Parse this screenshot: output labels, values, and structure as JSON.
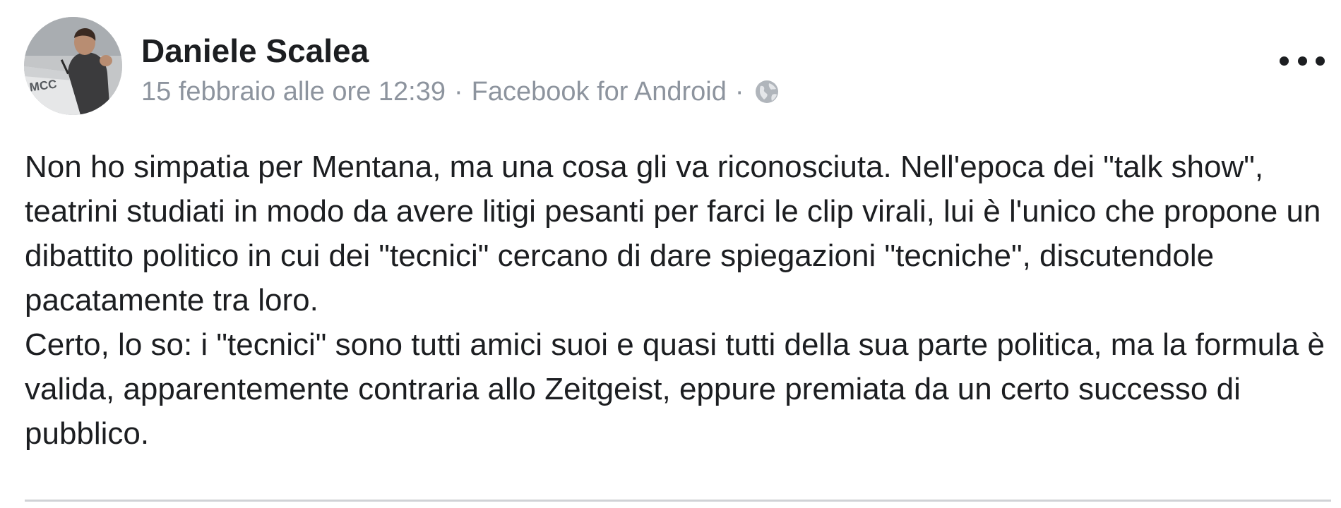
{
  "post": {
    "author_name": "Daniele Scalea",
    "meta": {
      "date": "15 febbraio alle ore 12:39",
      "separator": "·",
      "source": "Facebook for Android",
      "privacy_icon": "globe-icon"
    },
    "avatar": {
      "sign_text": "MCC"
    },
    "paragraphs": [
      "Non ho simpatia per Mentana, ma una cosa gli va riconosciuta. Nell'epoca dei \"talk show\", teatrini studiati in modo da avere litigi pesanti per farci le clip virali, lui è l'unico che propone un dibattito politico in cui dei \"tecnici\" cercano di dare spiegazioni \"tecniche\", discutendole pacatamente tra loro.",
      "Certo, lo so: i \"tecnici\" sono tutti amici suoi e quasi tutti della sua parte politica, ma la formula è valida, apparentemente contraria allo Zeitgeist, eppure premiata da un certo successo di pubblico."
    ],
    "more_icon": "more-options-icon"
  },
  "colors": {
    "text": "#1c1e21",
    "meta_text": "#8d949e",
    "divider": "#d0d2d6"
  }
}
